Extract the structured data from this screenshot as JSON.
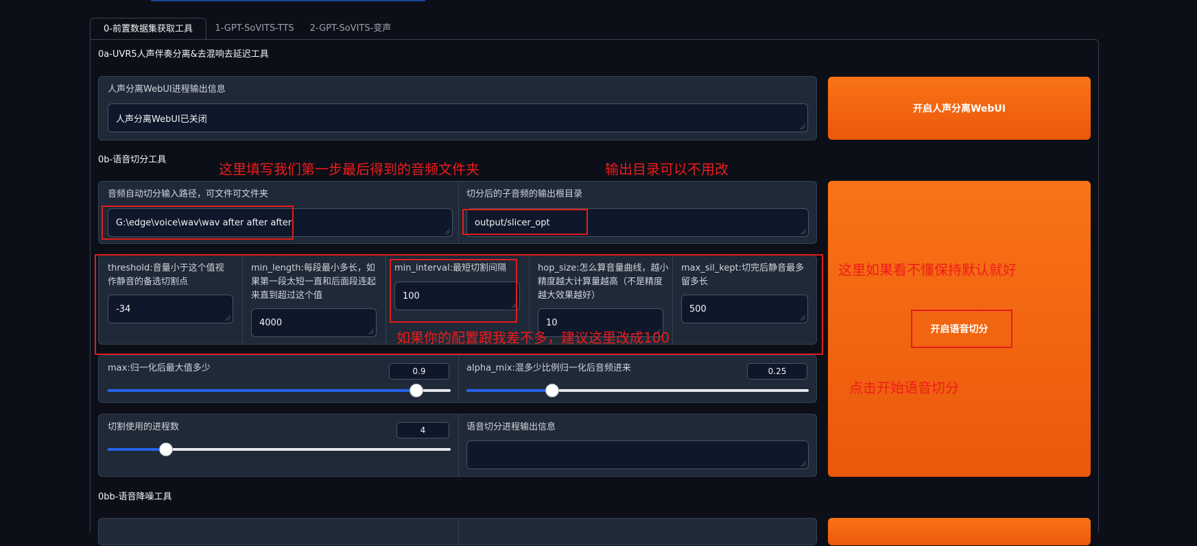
{
  "tabs": [
    {
      "label": "0-前置数据集获取工具"
    },
    {
      "label": "1-GPT-SoVITS-TTS"
    },
    {
      "label": "2-GPT-SoVITS-变声"
    }
  ],
  "uvr": {
    "section_title": "0a-UVR5人声伴奏分离&去混响去延迟工具",
    "info_label": "人声分离WebUI进程输出信息",
    "info_value": "人声分离WebUI已关闭",
    "button_label": "开启人声分离WebUI"
  },
  "slicer": {
    "section_title": "0b-语音切分工具",
    "input_path_label": "音频自动切分输入路径，可文件可文件夹",
    "input_path_value": "G:\\edge\\voice\\wav\\wav after after after",
    "output_dir_label": "切分后的子音频的输出根目录",
    "output_dir_value": "output/slicer_opt",
    "params": [
      {
        "label": "threshold:音量小于这个值视作静音的备选切割点",
        "value": "-34"
      },
      {
        "label": "min_length:每段最小多长，如果第一段太短一直和后面段连起来直到超过这个值",
        "value": "4000"
      },
      {
        "label": "min_interval:最短切割间隔",
        "value": "100"
      },
      {
        "label": "hop_size:怎么算音量曲线，越小精度越大计算量越高（不是精度越大效果越好）",
        "value": "10"
      },
      {
        "label": "max_sil_kept:切完后静音最多留多长",
        "value": "500"
      }
    ],
    "max_label": "max:归一化后最大值多少",
    "max_value": "0.9",
    "max_level": 0.9,
    "alpha_label": "alpha_mix:混多少比例归一化后音频进来",
    "alpha_value": "0.25",
    "alpha_level": 0.25,
    "procs_label": "切割使用的进程数",
    "procs_value": "4",
    "procs_level": 0.17,
    "log_label": "语音切分进程输出信息",
    "log_value": "",
    "button_label": "开启语音切分"
  },
  "denoise": {
    "section_title": "0bb-语音降噪工具"
  },
  "annotations": {
    "input_hint": "这里填写我们第一步最后得到的音频文件夹",
    "output_hint": "输出目录可以不用改",
    "params_hint": "这里如果看不懂保持默认就好",
    "interval_hint": "如果你的配置跟我差不多，建议这里改成100",
    "click_hint": "点击开始语音切分"
  },
  "colors": {
    "accent": "#f97316",
    "annotation": "#ef1b1b",
    "slider_fill": "#2563eb",
    "background": "#0c0f17",
    "panel": "#1f2937"
  }
}
